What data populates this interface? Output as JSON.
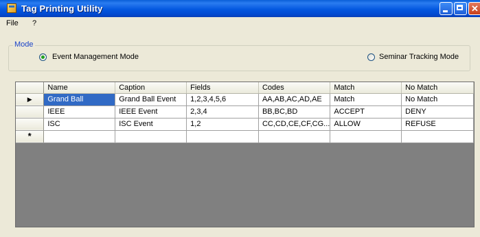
{
  "window": {
    "title": "Tag Printing Utility"
  },
  "menu": {
    "items": [
      {
        "label": "File"
      },
      {
        "label": "?"
      }
    ]
  },
  "mode": {
    "legend": "Mode",
    "options": [
      {
        "label": "Event Management Mode",
        "checked": true
      },
      {
        "label": "Seminar Tracking Mode",
        "checked": false
      }
    ]
  },
  "grid": {
    "columns": [
      "Name",
      "Caption",
      "Fields",
      "Codes",
      "Match",
      "No Match"
    ],
    "rows": [
      {
        "name": "Grand Ball",
        "caption": "Grand Ball Event",
        "fields": "1,2,3,4,5,6",
        "codes": "AA,AB,AC,AD,AE",
        "match": "Match",
        "no_match": "No Match"
      },
      {
        "name": "IEEE",
        "caption": "IEEE Event",
        "fields": "2,3,4",
        "codes": "BB,BC,BD",
        "match": "ACCEPT",
        "no_match": "DENY"
      },
      {
        "name": "ISC",
        "caption": "ISC Event",
        "fields": "1,2",
        "codes": "CC,CD,CE,CF,CG...",
        "match": "ALLOW",
        "no_match": "REFUSE"
      }
    ],
    "current_row_marker": "▶",
    "new_row_marker": "*"
  },
  "colors": {
    "title_bar": "#0458e0",
    "selection": "#316ac5",
    "grid_background": "#808080",
    "legend_text": "#1a43c8"
  }
}
